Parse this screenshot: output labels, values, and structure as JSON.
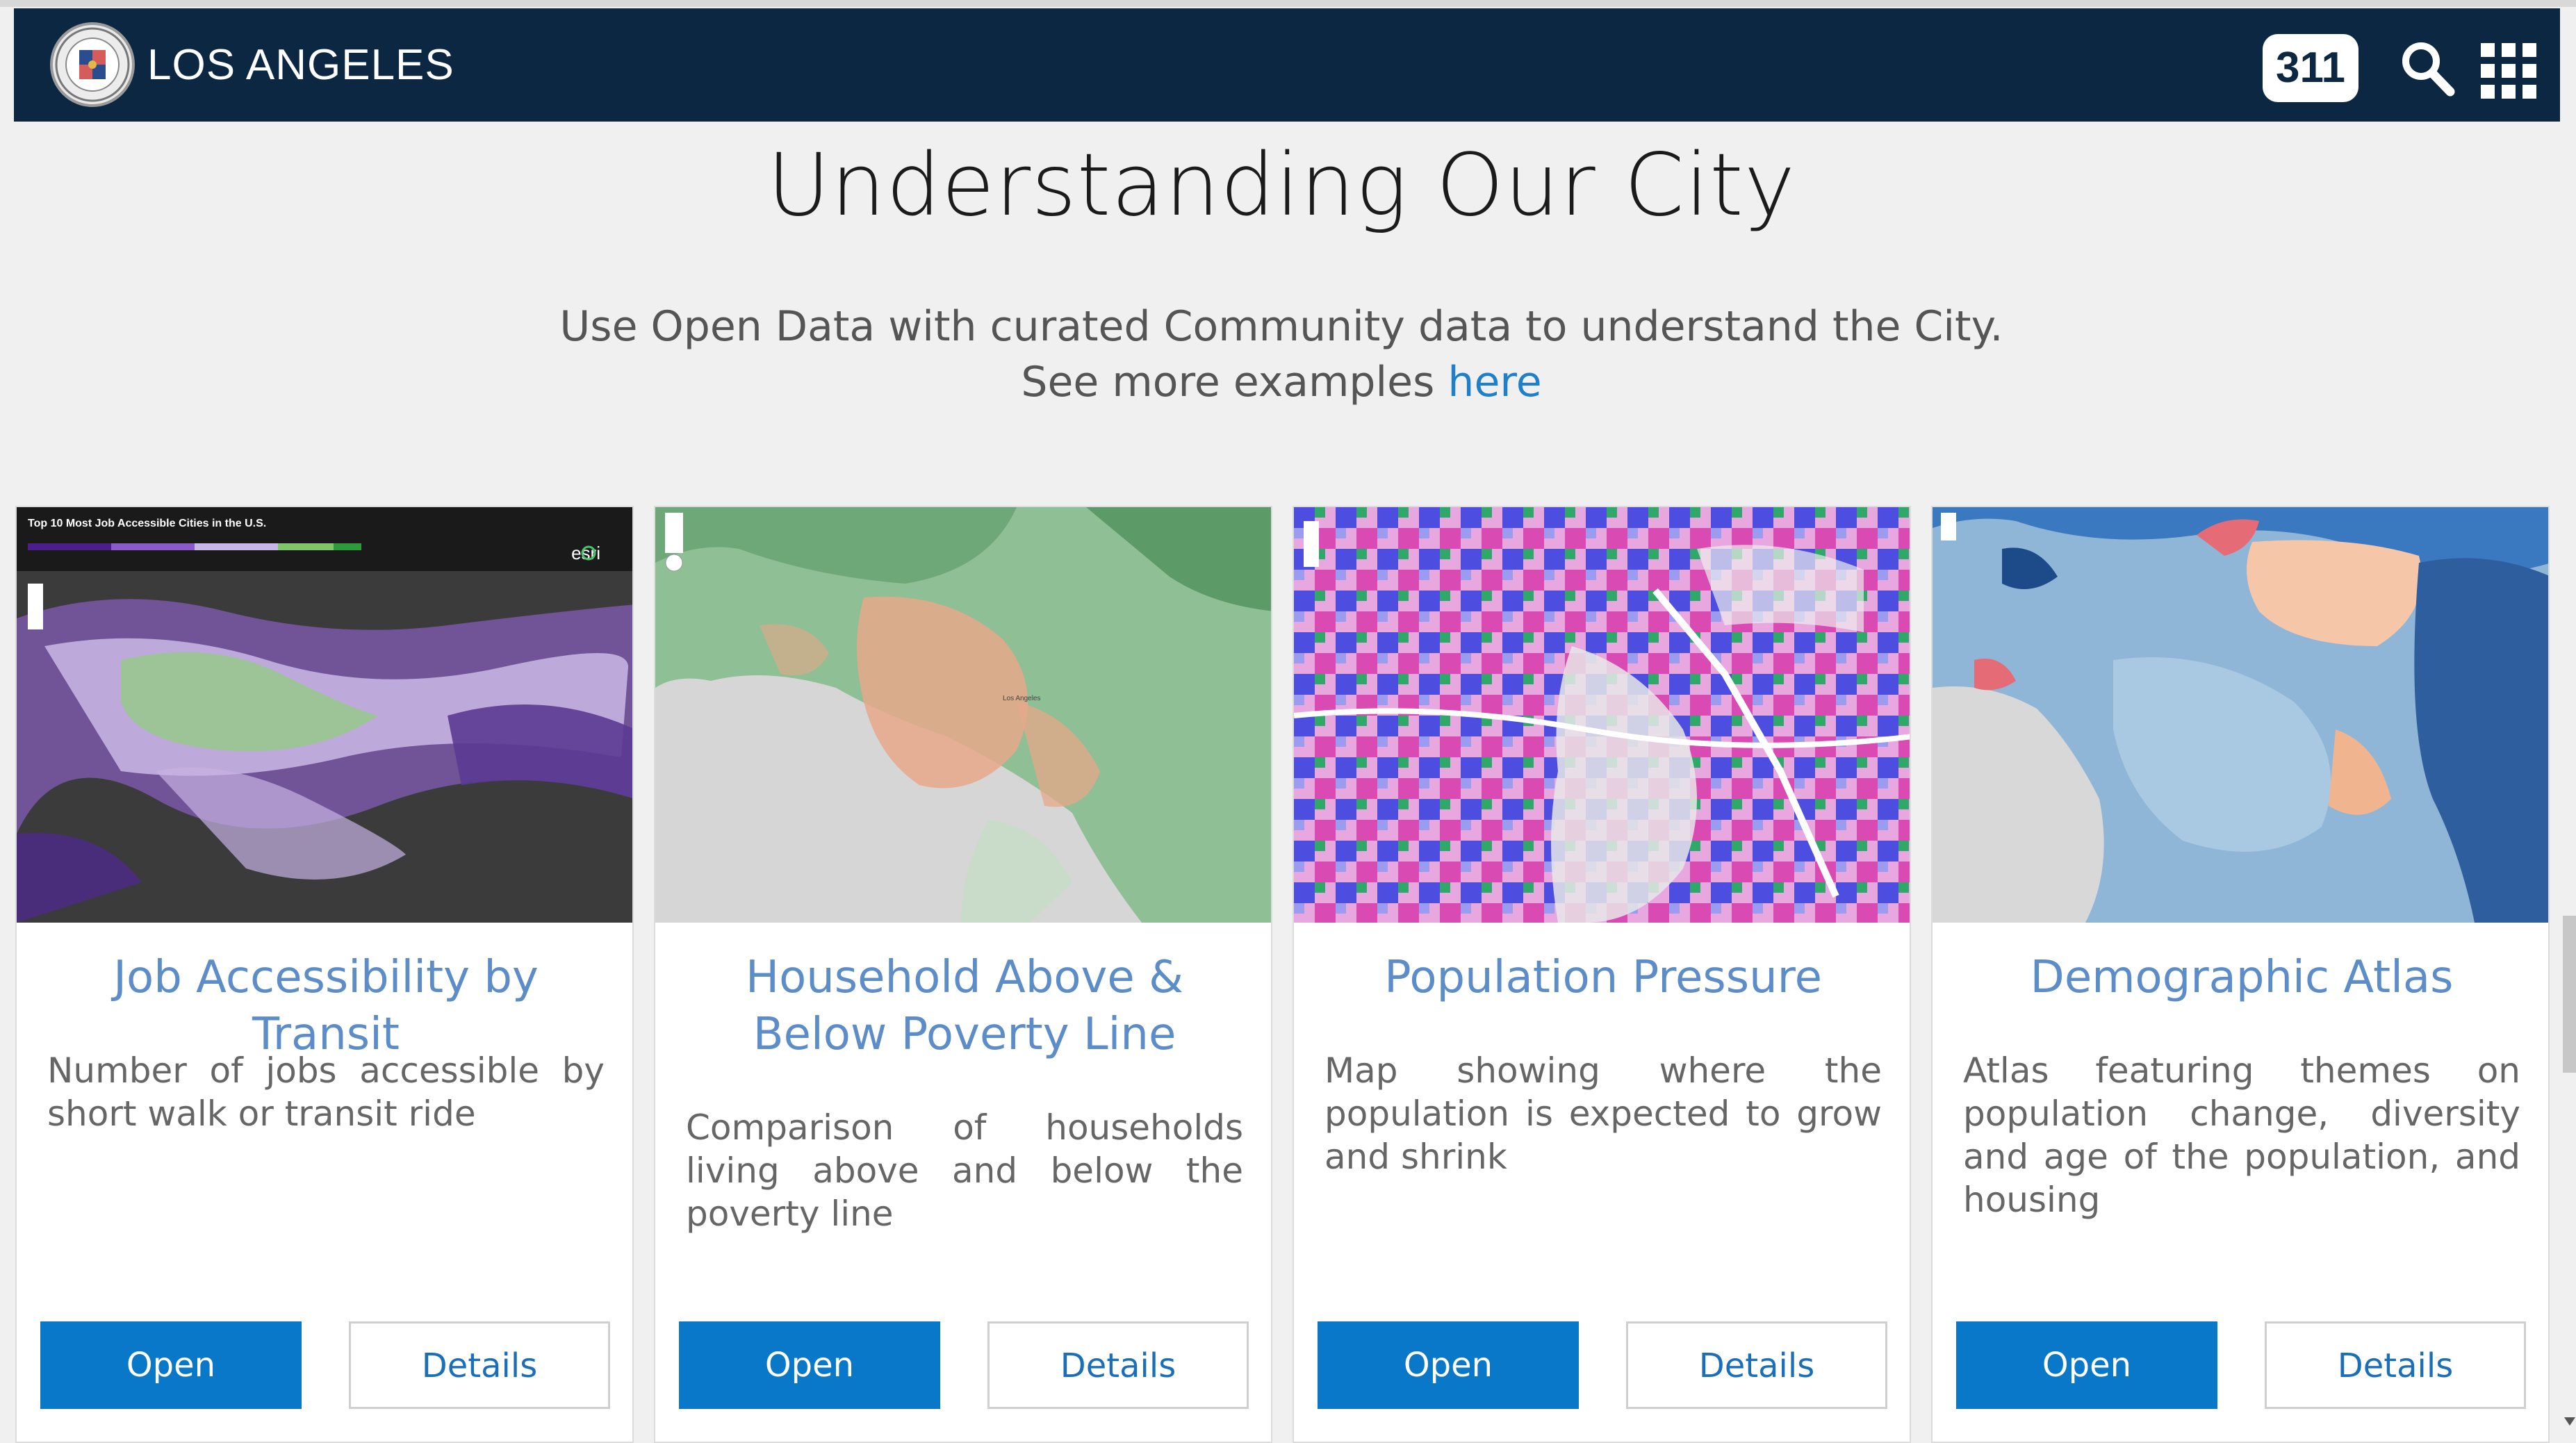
{
  "header": {
    "brand": "LOS ANGELES",
    "badge_311": "311",
    "icons": {
      "seal": "city-seal-icon",
      "search": "search-icon",
      "apps": "apps-grid-icon"
    }
  },
  "main": {
    "title": "Understanding Our City",
    "intro_text": "Use Open Data with curated Community data to understand the City. See more examples ",
    "intro_link": "here"
  },
  "cards": [
    {
      "title": "Job Accessibility by Transit",
      "description": "Number of jobs accessible by short walk or transit ride",
      "open_label": "Open",
      "details_label": "Details",
      "thumbnail_title": "Top 10 Most Job Accessible Cities in the U.S.",
      "thumbnail_logo": "esri"
    },
    {
      "title": "Household Above & Below Poverty Line",
      "description": "Comparison of households living above and below the poverty line",
      "open_label": "Open",
      "details_label": "Details",
      "thumbnail_label": "Los Angeles"
    },
    {
      "title": "Population Pressure",
      "description": "Map showing where the population is expected to grow and shrink",
      "open_label": "Open",
      "details_label": "Details"
    },
    {
      "title": "Demographic Atlas",
      "description": "Atlas featuring themes on population change, diversity and age of the population, and housing",
      "open_label": "Open",
      "details_label": "Details"
    }
  ],
  "colors": {
    "navbar": "#0c2741",
    "accent_blue": "#0a78c8",
    "title_blue": "#5d8dc9",
    "link_blue": "#1e7fcb"
  }
}
